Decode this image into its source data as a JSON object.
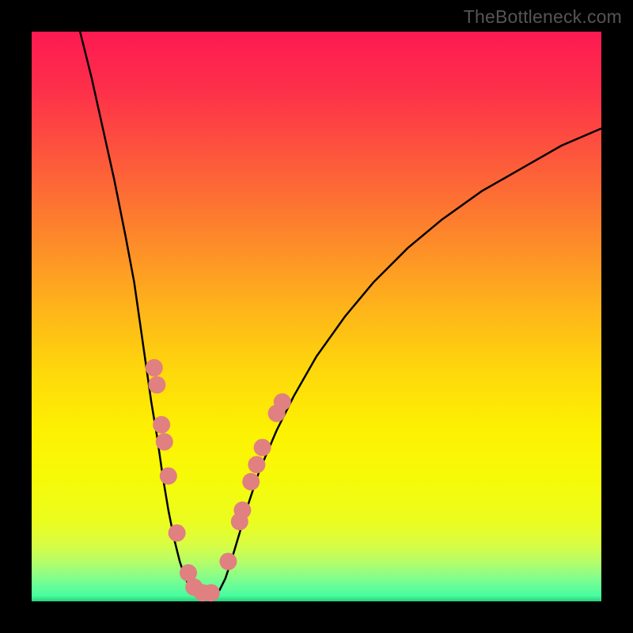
{
  "watermark": "TheBottleneck.com",
  "chart_data": {
    "type": "line",
    "title": "",
    "xlabel": "",
    "ylabel": "",
    "xlim": [
      0,
      100
    ],
    "ylim": [
      0,
      100
    ],
    "gradient_stops": [
      {
        "offset": 0.0,
        "color": "#fd1a52"
      },
      {
        "offset": 0.1,
        "color": "#fd2f4a"
      },
      {
        "offset": 0.22,
        "color": "#fd573c"
      },
      {
        "offset": 0.35,
        "color": "#fd842c"
      },
      {
        "offset": 0.48,
        "color": "#feb21b"
      },
      {
        "offset": 0.6,
        "color": "#fed90b"
      },
      {
        "offset": 0.7,
        "color": "#fdf102"
      },
      {
        "offset": 0.78,
        "color": "#f7fa07"
      },
      {
        "offset": 0.86,
        "color": "#ebfd1f"
      },
      {
        "offset": 0.9,
        "color": "#d9fd43"
      },
      {
        "offset": 0.93,
        "color": "#b6fd67"
      },
      {
        "offset": 0.95,
        "color": "#94fd82"
      },
      {
        "offset": 0.97,
        "color": "#6dfd96"
      },
      {
        "offset": 0.99,
        "color": "#48fda0"
      },
      {
        "offset": 1.0,
        "color": "#2cce7c"
      }
    ],
    "series": [
      {
        "name": "bottleneck-curve",
        "color": "#000000",
        "points": [
          {
            "x": 8.5,
            "y": 100
          },
          {
            "x": 10.5,
            "y": 92
          },
          {
            "x": 12.5,
            "y": 83
          },
          {
            "x": 14.5,
            "y": 74
          },
          {
            "x": 16.5,
            "y": 64
          },
          {
            "x": 18.0,
            "y": 56
          },
          {
            "x": 19.0,
            "y": 49
          },
          {
            "x": 20.0,
            "y": 42
          },
          {
            "x": 21.0,
            "y": 35
          },
          {
            "x": 22.0,
            "y": 29
          },
          {
            "x": 23.0,
            "y": 22
          },
          {
            "x": 24.0,
            "y": 16
          },
          {
            "x": 25.0,
            "y": 11
          },
          {
            "x": 26.0,
            "y": 7
          },
          {
            "x": 27.0,
            "y": 4
          },
          {
            "x": 28.0,
            "y": 2
          },
          {
            "x": 29.0,
            "y": 1
          },
          {
            "x": 30.0,
            "y": 0.5
          },
          {
            "x": 31.0,
            "y": 0.5
          },
          {
            "x": 32.0,
            "y": 1
          },
          {
            "x": 33.0,
            "y": 2
          },
          {
            "x": 34.0,
            "y": 4
          },
          {
            "x": 35.0,
            "y": 7
          },
          {
            "x": 36.5,
            "y": 12
          },
          {
            "x": 38.0,
            "y": 17
          },
          {
            "x": 40.0,
            "y": 23
          },
          {
            "x": 43.0,
            "y": 30
          },
          {
            "x": 46.0,
            "y": 36
          },
          {
            "x": 50.0,
            "y": 43
          },
          {
            "x": 55.0,
            "y": 50
          },
          {
            "x": 60.0,
            "y": 56
          },
          {
            "x": 66.0,
            "y": 62
          },
          {
            "x": 72.0,
            "y": 67
          },
          {
            "x": 79.0,
            "y": 72
          },
          {
            "x": 86.0,
            "y": 76
          },
          {
            "x": 93.0,
            "y": 80
          },
          {
            "x": 100.0,
            "y": 83
          }
        ]
      }
    ],
    "markers": {
      "name": "highlight-points",
      "color": "#e08080",
      "radius": 11,
      "points": [
        {
          "x": 21.5,
          "y": 41
        },
        {
          "x": 22.0,
          "y": 38
        },
        {
          "x": 22.8,
          "y": 31
        },
        {
          "x": 23.3,
          "y": 28
        },
        {
          "x": 24.0,
          "y": 22
        },
        {
          "x": 25.5,
          "y": 12
        },
        {
          "x": 27.5,
          "y": 5
        },
        {
          "x": 28.5,
          "y": 2.5
        },
        {
          "x": 30.0,
          "y": 1.5
        },
        {
          "x": 31.5,
          "y": 1.5
        },
        {
          "x": 34.5,
          "y": 7
        },
        {
          "x": 36.5,
          "y": 14
        },
        {
          "x": 37.0,
          "y": 16
        },
        {
          "x": 38.5,
          "y": 21
        },
        {
          "x": 39.5,
          "y": 24
        },
        {
          "x": 40.5,
          "y": 27
        },
        {
          "x": 43.0,
          "y": 33
        },
        {
          "x": 44.0,
          "y": 35
        }
      ]
    }
  }
}
